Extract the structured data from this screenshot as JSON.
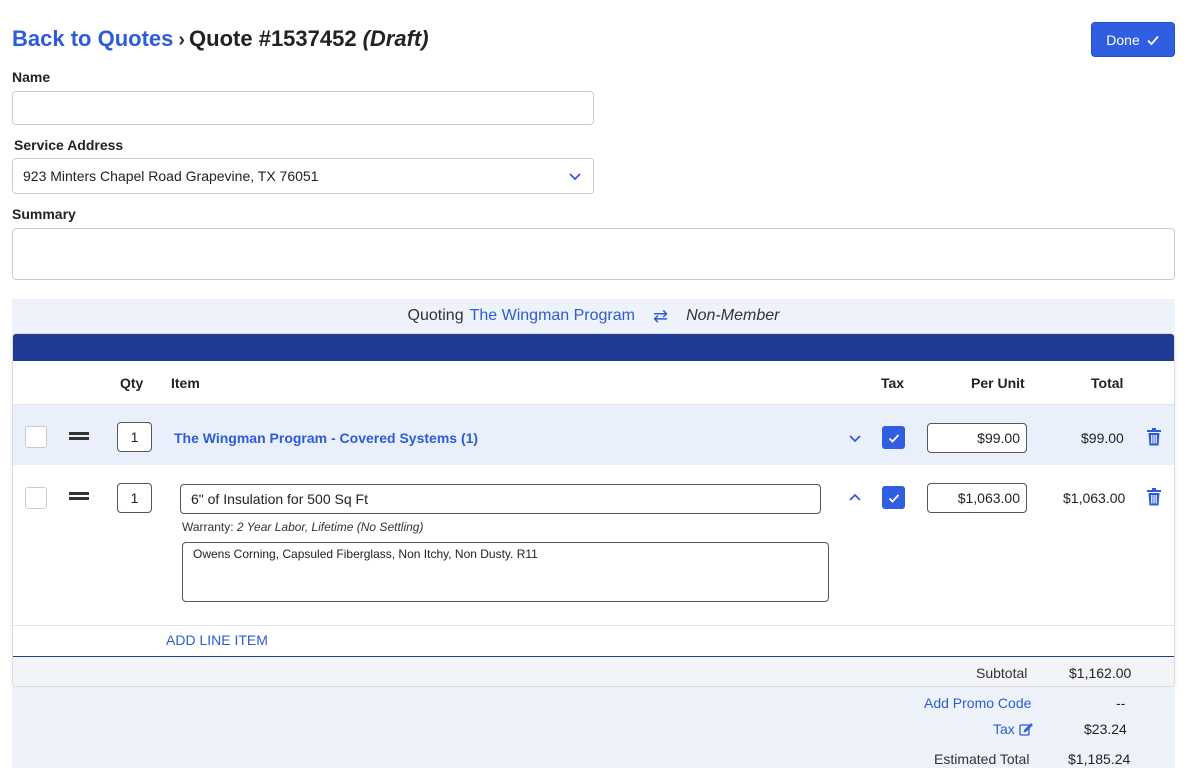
{
  "header": {
    "back_label": "Back to Quotes",
    "quote_title": "Quote #1537452",
    "status": "(Draft)",
    "done_label": "Done"
  },
  "form": {
    "name_label": "Name",
    "name_value": "",
    "service_address_label": "Service Address",
    "service_address_value": "923 Minters Chapel Road Grapevine, TX 76051",
    "summary_label": "Summary",
    "summary_value": ""
  },
  "quoting": {
    "prefix": "Quoting",
    "program": "The Wingman Program",
    "membership": "Non-Member"
  },
  "table": {
    "headers": {
      "qty": "Qty",
      "item": "Item",
      "tax": "Tax",
      "per_unit": "Per Unit",
      "total": "Total"
    },
    "rows": [
      {
        "qty": "1",
        "item": "The Wingman Program - Covered Systems (1)",
        "taxed": true,
        "per_unit": "$99.00",
        "total": "$99.00"
      },
      {
        "qty": "1",
        "item": "6\" of Insulation for 500 Sq Ft",
        "warranty_label": "Warranty:",
        "warranty_value": "2 Year Labor, Lifetime (No Settling)",
        "description": "Owens Corning, Capsuled Fiberglass, Non Itchy, Non Dusty. R11",
        "taxed": true,
        "per_unit": "$1,063.00",
        "total": "$1,063.00"
      }
    ],
    "add_line_label": "ADD LINE ITEM"
  },
  "totals": {
    "subtotal_label": "Subtotal",
    "subtotal_value": "$1,162.00",
    "promo_label": "Add Promo Code",
    "promo_value": "--",
    "tax_label": "Tax",
    "tax_value": "$23.24",
    "estimated_label": "Estimated Total",
    "estimated_value": "$1,185.24"
  },
  "colors": {
    "accent": "#2e5bd6",
    "band": "#1f3a93"
  }
}
